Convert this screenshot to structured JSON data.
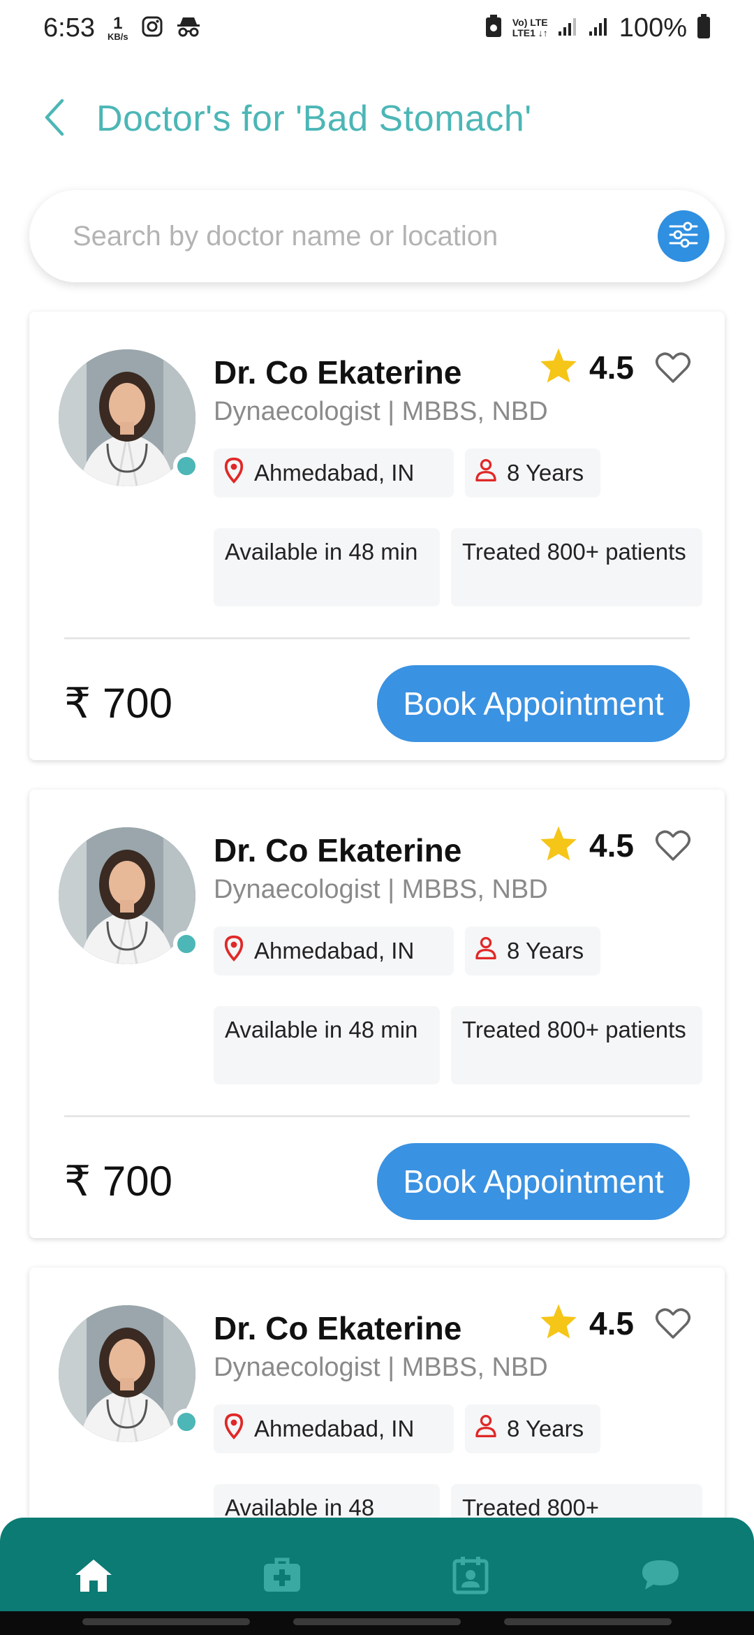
{
  "status_bar": {
    "time": "6:53",
    "speed_value": "1",
    "speed_unit": "KB/s",
    "net_top": "Vo) LTE",
    "net_bottom": "LTE1 ↓↑",
    "battery": "100%"
  },
  "header": {
    "title": "Doctor's for 'Bad Stomach'"
  },
  "search": {
    "placeholder": "Search by doctor name or location"
  },
  "doctors": [
    {
      "name": "Dr. Co Ekaterine",
      "rating": "4.5",
      "specialty": "Dynaecologist | MBBS, NBD",
      "location": "Ahmedabad, IN",
      "experience": "8 Years",
      "availability": "Available in 48 min",
      "treated": "Treated 800+ patients",
      "price": "₹ 700",
      "book_label": "Book Appointment"
    },
    {
      "name": "Dr. Co Ekaterine",
      "rating": "4.5",
      "specialty": "Dynaecologist | MBBS, NBD",
      "location": "Ahmedabad, IN",
      "experience": "8 Years",
      "availability": "Available in 48 min",
      "treated": "Treated 800+ patients",
      "price": "₹ 700",
      "book_label": "Book Appointment"
    },
    {
      "name": "Dr. Co Ekaterine",
      "rating": "4.5",
      "specialty": "Dynaecologist | MBBS, NBD",
      "location": "Ahmedabad, IN",
      "experience": "8 Years",
      "availability": "Available in 48",
      "treated": "Treated 800+",
      "price": "",
      "book_label": ""
    }
  ],
  "bottom_nav": {
    "items": [
      "home-icon",
      "medical-kit-icon",
      "calendar-profile-icon",
      "chat-icon"
    ],
    "active": "home-icon"
  },
  "colors": {
    "accent_teal": "#4cb6b6",
    "nav_bg": "#0b7b74",
    "button_blue": "#3a92e2",
    "star": "#f5c518",
    "pin_red": "#e02828"
  }
}
